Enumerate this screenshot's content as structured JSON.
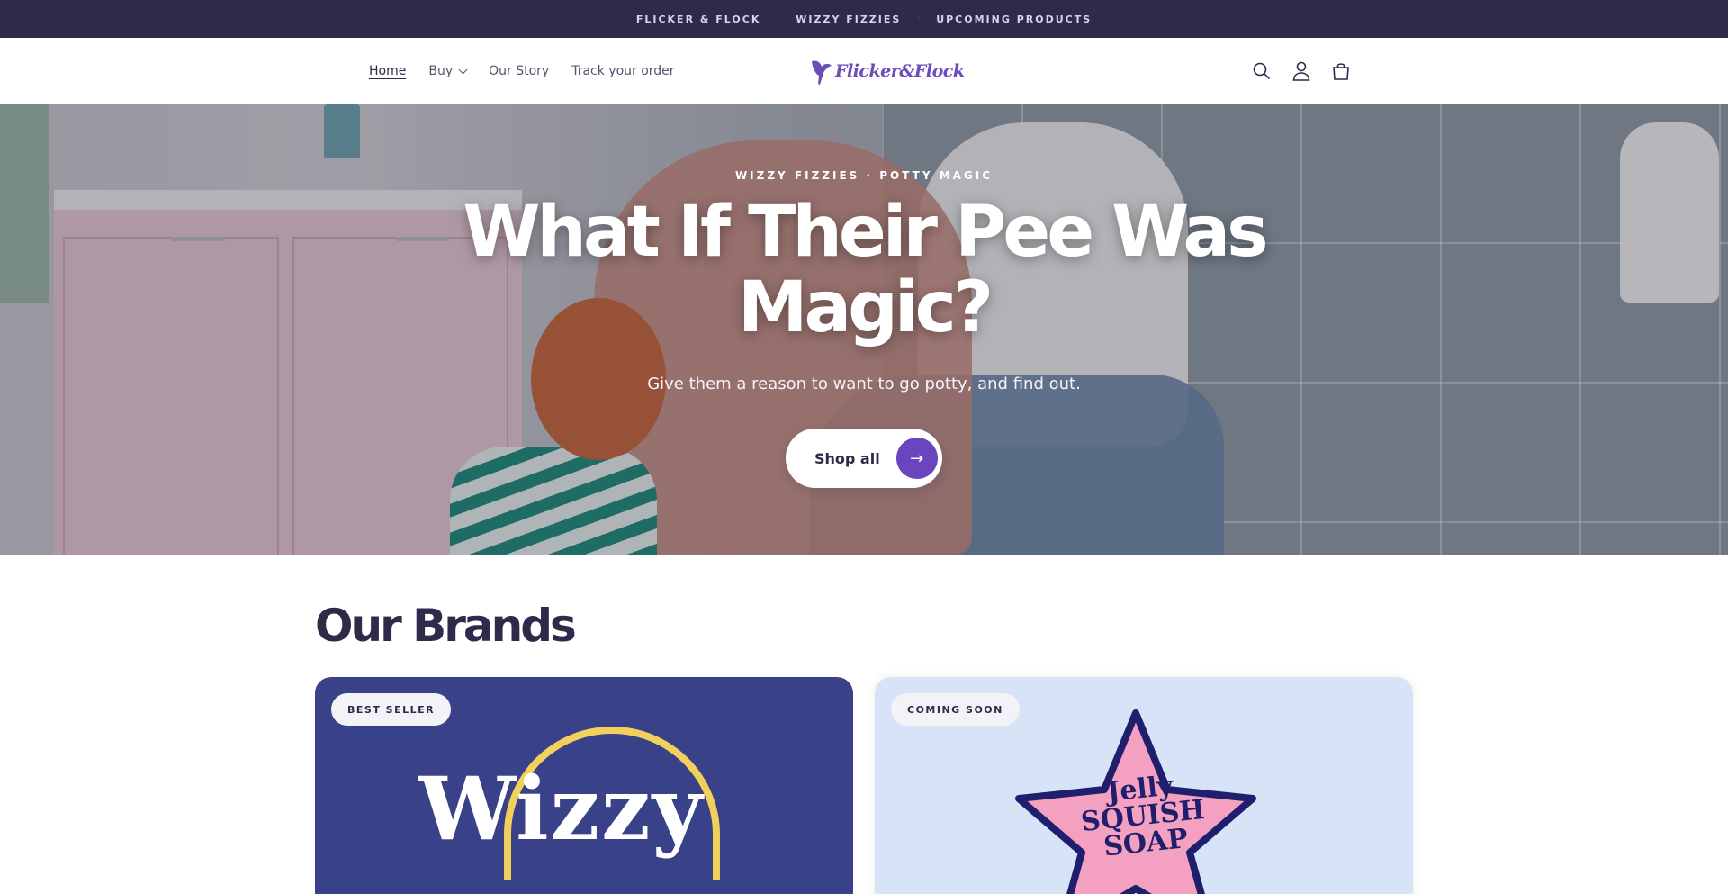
{
  "announcement_bar": {
    "links": [
      "FLICKER & FLOCK",
      "WIZZY FIZZIES",
      "UPCOMING PRODUCTS"
    ],
    "separator": "·"
  },
  "header": {
    "nav": {
      "home": "Home",
      "buy": "Buy",
      "our_story": "Our Story",
      "track_order": "Track your order"
    },
    "logo_text": "Flicker&Flock",
    "icons": [
      "search-icon",
      "account-icon",
      "cart-icon"
    ]
  },
  "hero": {
    "eyebrow": "WIZZY FIZZIES · POTTY MAGIC",
    "title": "What If Their Pee Was Magic?",
    "subtitle": "Give them a reason to want to go potty, and find out.",
    "cta_label": "Shop all",
    "cta_icon": "→"
  },
  "brands": {
    "heading": "Our Brands",
    "cards": [
      {
        "badge": "BEST SELLER",
        "logo_text": "Wizzy"
      },
      {
        "badge": "COMING SOON",
        "logo_text": "Jelly SQUISH SOAP"
      }
    ]
  },
  "colors": {
    "announcement_bg": "#2d2a4a",
    "accent_purple": "#6a45bd",
    "wizzy_card_bg": "#394189",
    "jelly_card_bg": "#d7e4f8"
  }
}
